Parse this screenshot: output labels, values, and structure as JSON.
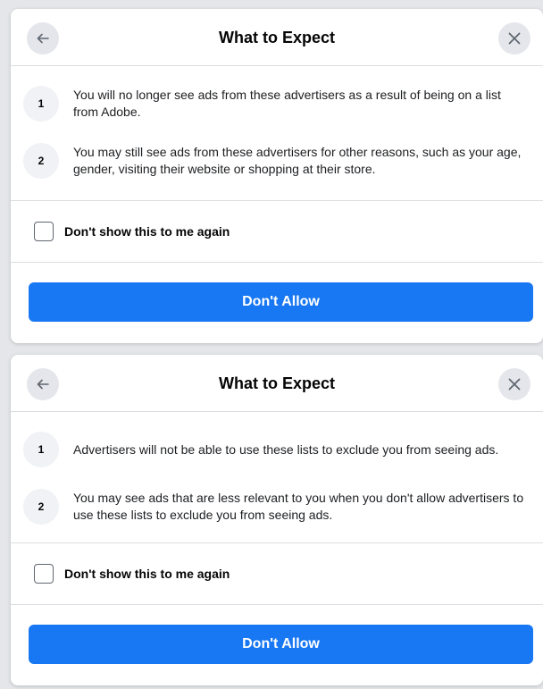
{
  "dialogs": [
    {
      "title": "What to Expect",
      "back_icon": "arrow-left-icon",
      "close_icon": "close-icon",
      "items": [
        {
          "number": "1",
          "text": "You will no longer see ads from these advertisers as a result of being on a list from Adobe."
        },
        {
          "number": "2",
          "text": "You may still see ads from these advertisers for other reasons, such as your age, gender, visiting their website or shopping at their store."
        }
      ],
      "checkbox_label": "Don't show this to me again",
      "checkbox_checked": false,
      "button_label": "Don't Allow"
    },
    {
      "title": "What to Expect",
      "back_icon": "arrow-left-icon",
      "close_icon": "close-icon",
      "items": [
        {
          "number": "1",
          "text": "Advertisers will not be able to use these lists to exclude you from seeing ads."
        },
        {
          "number": "2",
          "text": "You may see ads that are less relevant to you when you don't allow advertisers to use these lists to exclude you from seeing ads."
        }
      ],
      "checkbox_label": "Don't show this to me again",
      "checkbox_checked": false,
      "button_label": "Don't Allow"
    }
  ],
  "colors": {
    "primary": "#1877f2",
    "background": "#e4e6e9",
    "divider": "#dadde1"
  }
}
